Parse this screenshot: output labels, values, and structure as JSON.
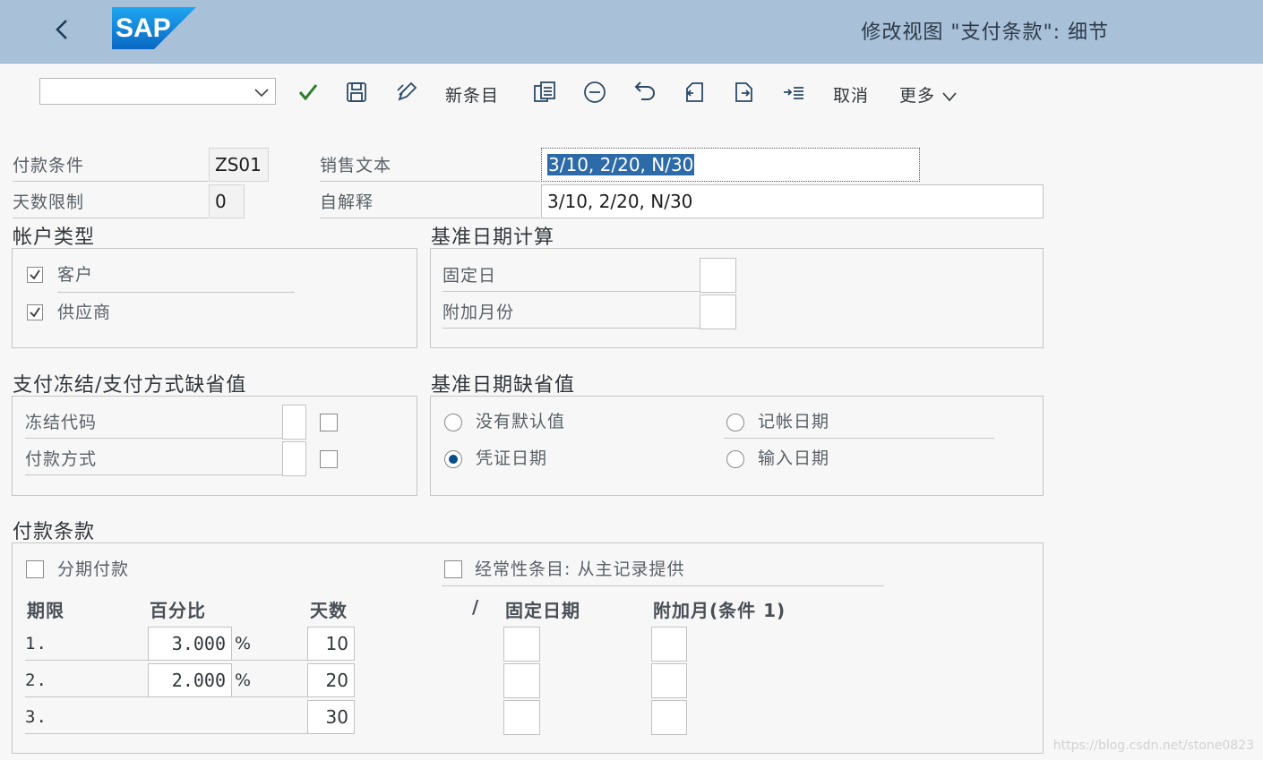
{
  "shell": {
    "title": "修改视图 \"支付条款\": 细节",
    "logo_text": "SAP",
    "brand_color": "#0a6ed1"
  },
  "toolbar": {
    "combo_value": "",
    "new_entry_label": "新条目",
    "cancel_label": "取消",
    "more_label": "更多",
    "icons": [
      "check-icon",
      "save-icon",
      "edit-icon",
      "copy-icon",
      "delete-icon",
      "undo-icon",
      "previous-entry-icon",
      "next-entry-icon",
      "select-icon"
    ]
  },
  "header": {
    "payment_terms_label": "付款条件",
    "payment_terms_value": "ZS01",
    "day_limit_label": "天数限制",
    "day_limit_value": "0",
    "sales_text_label": "销售文本",
    "sales_text_value": "3/10, 2/20, N/30",
    "explanation_label": "自解释",
    "explanation_value": "3/10, 2/20, N/30"
  },
  "account_type": {
    "title": "帐户类型",
    "customer_label": "客户",
    "customer_checked": true,
    "vendor_label": "供应商",
    "vendor_checked": true
  },
  "baseline_calc": {
    "title": "基准日期计算",
    "fixed_day_label": "固定日",
    "fixed_day_value": "",
    "extra_months_label": "附加月份",
    "extra_months_value": ""
  },
  "payment_block": {
    "title": "支付冻结/支付方式缺省值",
    "block_key_label": "冻结代码",
    "payment_method_label": "付款方式"
  },
  "baseline_default": {
    "title": "基准日期缺省值",
    "no_default_label": "没有默认值",
    "posting_date_label": "记帐日期",
    "document_date_label": "凭证日期",
    "entry_date_label": "输入日期",
    "selected": "document_date"
  },
  "payment_terms": {
    "title": "付款条款",
    "installment_label": "分期付款",
    "recurring_label": "经常性条目: 从主记录提供",
    "col_term": "期限",
    "col_percent": "百分比",
    "col_days": "天数",
    "col_slash": "/",
    "col_fixed_date": "固定日期",
    "col_extra_month": "附加月(条件 1)",
    "percent_sign": "%",
    "rows": [
      {
        "term": "1.",
        "percent": "3.000",
        "days": "10"
      },
      {
        "term": "2.",
        "percent": "2.000",
        "days": "20"
      },
      {
        "term": "3.",
        "percent": "",
        "days": "30"
      }
    ]
  },
  "watermark": "https://blog.csdn.net/stone0823"
}
